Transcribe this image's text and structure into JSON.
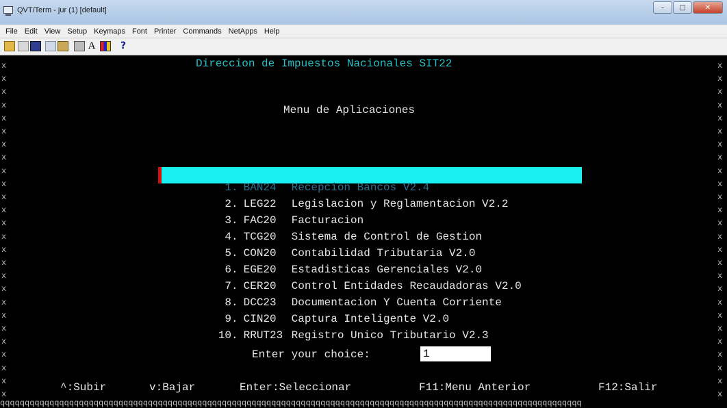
{
  "window": {
    "title": "QVT/Term - jur (1) [default]",
    "buttons": {
      "minimize": "–",
      "maximize": "□",
      "close": "✕"
    }
  },
  "menubar": [
    "File",
    "Edit",
    "View",
    "Setup",
    "Keymaps",
    "Font",
    "Printer",
    "Commands",
    "NetApps",
    "Help"
  ],
  "toolbar": {
    "font_label": "A",
    "help_label": "?"
  },
  "terminal": {
    "header": "Direccion de Impuestos Nacionales SIT22",
    "subheader": "Menu de Aplicaciones",
    "menu": [
      {
        "num": "1.",
        "code": "BAN24",
        "label": "Recepcion Bancos V2.4"
      },
      {
        "num": "2.",
        "code": "LEG22",
        "label": "Legislacion y Reglamentacion V2.2"
      },
      {
        "num": "3.",
        "code": "FAC20",
        "label": "Facturacion"
      },
      {
        "num": "4.",
        "code": "TCG20",
        "label": "Sistema de Control de Gestion"
      },
      {
        "num": "5.",
        "code": "CON20",
        "label": "Contabilidad Tributaria V2.0"
      },
      {
        "num": "6.",
        "code": "EGE20",
        "label": "Estadisticas Gerenciales V2.0"
      },
      {
        "num": "7.",
        "code": "CER20",
        "label": "Control Entidades Recaudadoras V2.0"
      },
      {
        "num": "8.",
        "code": "DCC23",
        "label": "Documentacion Y Cuenta Corriente"
      },
      {
        "num": "9.",
        "code": "CIN20",
        "label": "Captura Inteligente V2.0"
      },
      {
        "num": "10.",
        "code": "RRUT23",
        "label": "Registro Unico Tributario V2.3"
      }
    ],
    "selected_index": 0,
    "prompt": "Enter your choice:",
    "choice_value": "1",
    "footer": {
      "up": "^:Subir",
      "down": "v:Bajar",
      "enter": "Enter:Seleccionar",
      "f11": "F11:Menu Anterior",
      "f12": "F12:Salir"
    },
    "border_char": "x",
    "bottom_border_text": "qqqqqqqqqqqqqqqqqqqqqqqqqqqqqqqqqqqqqqqqqqqqqqqqqqqqqqqqqqqqqqqqqqqqqqqqqqqqqqqqqqqqqqqqqqqqqqqqqqqqqqqqqqqqqqqqqqqqqq"
  },
  "colors": {
    "terminal_bg": "#000000",
    "header_text": "#27c0c6",
    "menu_text": "#e6e6e6",
    "selection_bg": "#19f0f2"
  }
}
